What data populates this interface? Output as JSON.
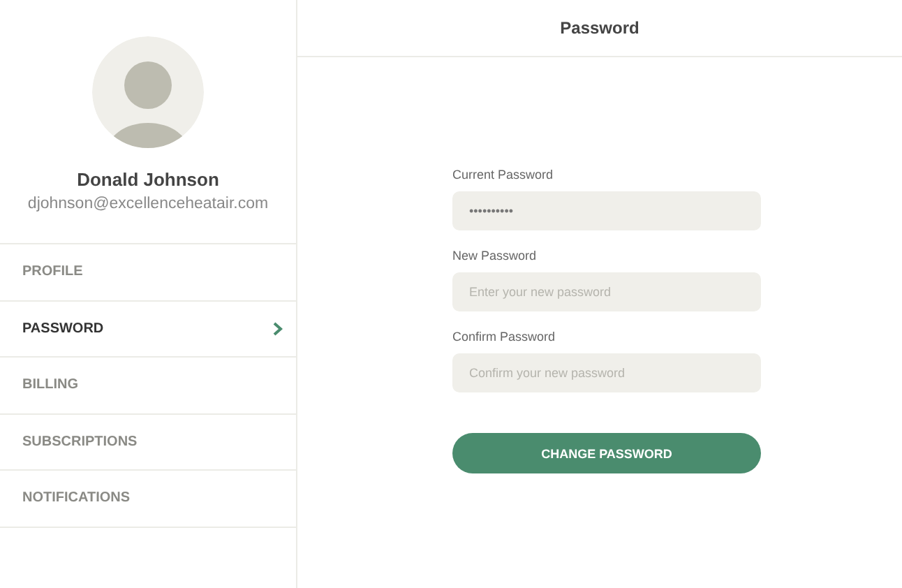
{
  "user": {
    "name": "Donald Johnson",
    "email": "djohnson@excellenceheatair.com"
  },
  "menu": [
    {
      "label": "PROFILE",
      "selected": false
    },
    {
      "label": "PASSWORD",
      "selected": true
    },
    {
      "label": "BILLING",
      "selected": false
    },
    {
      "label": "SUBSCRIPTIONS",
      "selected": false
    },
    {
      "label": "NOTIFICATIONS",
      "selected": false
    }
  ],
  "header": {
    "title": "Password"
  },
  "fields": [
    {
      "label": "Current Password",
      "value": "••••••••••"
    },
    {
      "label": "New Password",
      "placeholder": "Enter your new password"
    },
    {
      "label": "Confirm Password",
      "placeholder": "Confirm your new password"
    }
  ],
  "button": "CHANGE PASSWORD"
}
